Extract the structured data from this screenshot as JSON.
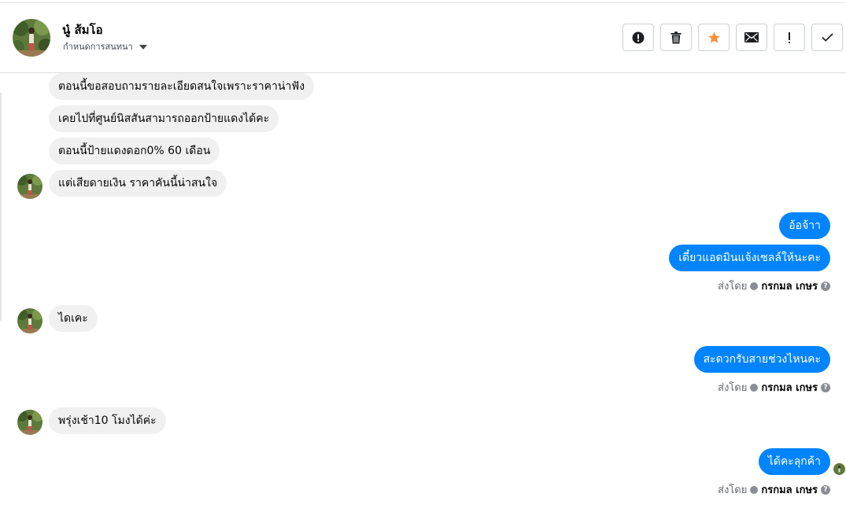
{
  "header": {
    "contact_name": "นู๋ ส้มโอ",
    "assign_label": "กำหนดการสนทนา",
    "actions": [
      {
        "name": "report-spam-button",
        "icon": "alert-circle-icon"
      },
      {
        "name": "delete-button",
        "icon": "trash-icon"
      },
      {
        "name": "star-button",
        "icon": "star-icon",
        "color": "#f7923b"
      },
      {
        "name": "mark-unread-button",
        "icon": "envelope-icon"
      },
      {
        "name": "follow-up-button",
        "icon": "exclamation-icon"
      },
      {
        "name": "mark-done-button",
        "icon": "check-icon"
      }
    ]
  },
  "messages": [
    {
      "direction": "in",
      "text": "ตอนนี้ขอสอบถามรายละเอียดสนใจเพราะราคาน่าฟัง"
    },
    {
      "direction": "in",
      "text": "เคยไปที่ศูนย์นิสสันสามารถออกป้ายแดงได้คะ"
    },
    {
      "direction": "in",
      "text": "ตอนนี้ป้ายแดงดอก0% 60 เดือน"
    },
    {
      "direction": "in",
      "text": "แต่เสียดายเงิน ราคาคันนี้น่าสนใจ"
    },
    {
      "direction": "out",
      "text": "อ้อจ้าา"
    },
    {
      "direction": "out",
      "text": "เดี๋ยวแอดมินแจ้งเซลล์ให้นะคะ"
    },
    {
      "direction": "in",
      "text": "ไดเคะ"
    },
    {
      "direction": "out",
      "text": "สะดวกรับสายช่วงไหนคะ"
    },
    {
      "direction": "in",
      "text": "พรุ่งเช้า10 โมงได้ค่ะ"
    },
    {
      "direction": "out",
      "text": "ได้คะลุกค้า"
    }
  ],
  "sent_by": {
    "prefix": "ส่งโดย",
    "agent": "กรกมล เกษร",
    "help": "?"
  },
  "colors": {
    "outgoing_bubble": "#0084ff",
    "incoming_bubble": "#f0f0f0",
    "star": "#f7923b"
  }
}
